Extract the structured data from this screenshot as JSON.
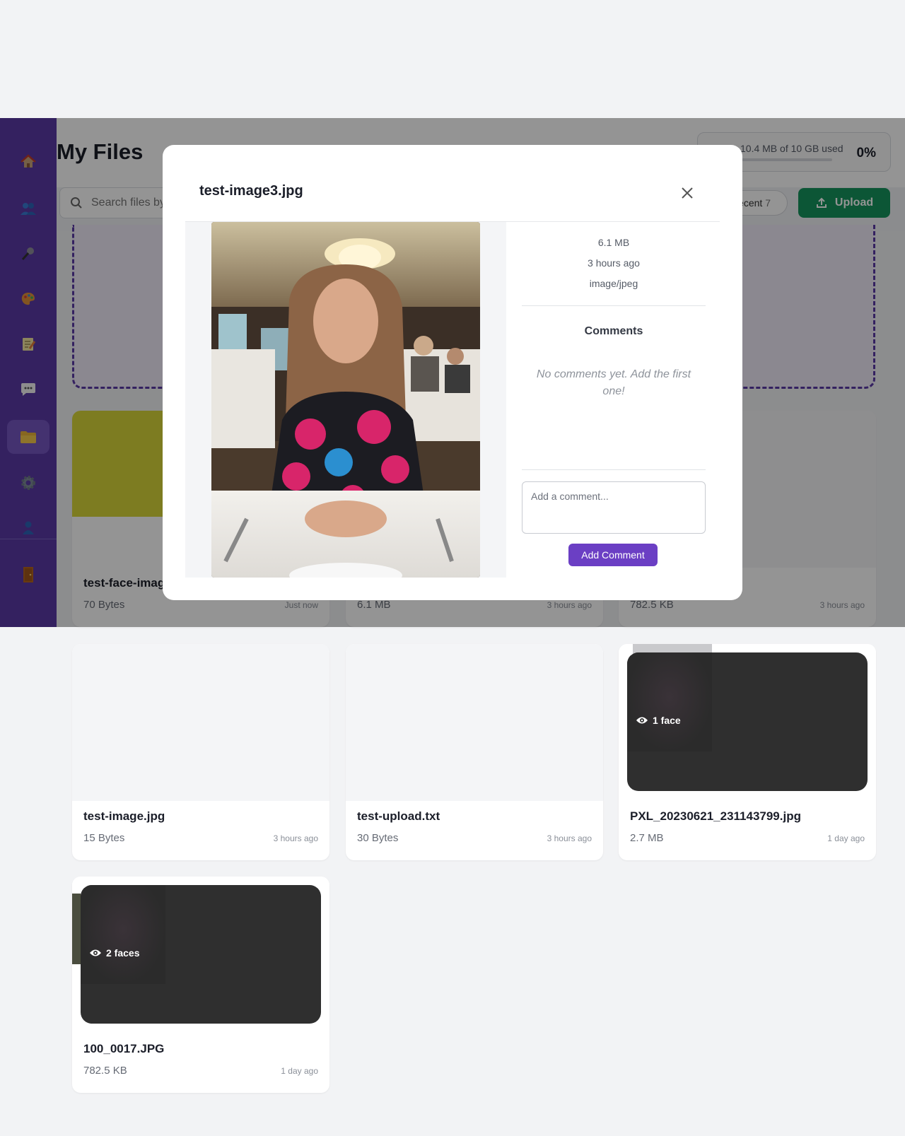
{
  "colors": {
    "sidebar": "#5b3aa6",
    "accent": "#6b3fc4",
    "upload": "#16955e"
  },
  "sidebar": {
    "items": [
      {
        "icon": "home-icon"
      },
      {
        "icon": "users-icon"
      },
      {
        "icon": "microphone-icon"
      },
      {
        "icon": "palette-icon"
      },
      {
        "icon": "notepad-icon"
      },
      {
        "icon": "chat-icon"
      },
      {
        "icon": "folder-icon",
        "active": true
      },
      {
        "icon": "gear-icon"
      },
      {
        "icon": "person-icon"
      },
      {
        "icon": "door-icon"
      }
    ]
  },
  "header": {
    "title": "My Files",
    "storage_text": "10.4 MB of 10 GB used",
    "storage_percent": "0%"
  },
  "toolbar": {
    "search_placeholder": "Search files by",
    "recent_label": "Recent",
    "recent_count": "7",
    "upload_label": "Upload"
  },
  "files": [
    {
      "name": "test-face-imag",
      "size": "70 Bytes",
      "ago": "Just now"
    },
    {
      "name": "",
      "size": "6.1 MB",
      "ago": "3 hours ago"
    },
    {
      "name": "",
      "size": "782.5 KB",
      "ago": "3 hours ago"
    },
    {
      "name": "test-image.jpg",
      "size": "15 Bytes",
      "ago": "3 hours ago"
    },
    {
      "name": "test-upload.txt",
      "size": "30 Bytes",
      "ago": "3 hours ago"
    },
    {
      "name": "PXL_20230621_231143799.jpg",
      "size": "2.7 MB",
      "ago": "1 day ago",
      "faces": "1 face"
    },
    {
      "name": "100_0017.JPG",
      "size": "782.5 KB",
      "ago": "1 day ago",
      "faces": "2 faces"
    }
  ],
  "modal": {
    "title": "test-image3.jpg",
    "size": "6.1 MB",
    "ago": "3 hours ago",
    "mime": "image/jpeg",
    "comments_title": "Comments",
    "no_comments": "No comments yet. Add the first one!",
    "comment_placeholder": "Add a comment...",
    "add_comment_label": "Add Comment"
  }
}
